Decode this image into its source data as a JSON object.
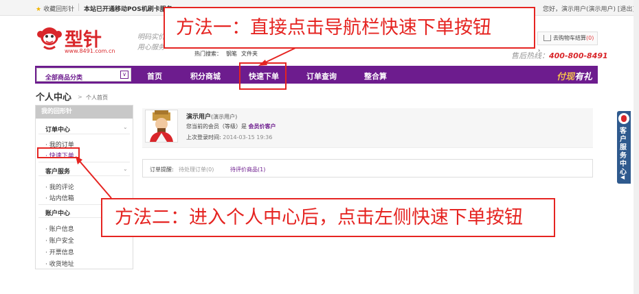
{
  "topbar": {
    "favorite": "收藏回形针",
    "notice": "本站已开通移动POS机刷卡服务",
    "user": "您好，演示用户(演示用户) [退出]"
  },
  "header": {
    "logo_text": "型针",
    "logo_url": "www.8491.com.cn",
    "slogan_line1": "明码实价",
    "slogan_line2": "用心服务",
    "hot_label": "热门搜索：",
    "hot_links": [
      "钢笔",
      "文件夹"
    ],
    "cart_label": "去购物车结算",
    "cart_count": "(0)",
    "hotline_label": "售后热线：",
    "hotline_number": "400-800-8491"
  },
  "nav": {
    "category_label": "全部商品分类",
    "items": [
      "首页",
      "积分商城",
      "快速下单",
      "订单查询",
      "整合算"
    ],
    "promo_a": "付现",
    "promo_b": "有礼"
  },
  "breadcrumb": {
    "title": "个人中心",
    "sep": ">",
    "page": "个人首页"
  },
  "sidebar": {
    "header": "我的回形针",
    "groups": [
      {
        "title": "订单中心",
        "items": [
          "· 我的订单",
          "· 快速下单"
        ]
      },
      {
        "title": "客户服务",
        "items": [
          "· 我的评论",
          "· 站内信箱"
        ]
      },
      {
        "title": "账户中心",
        "items": [
          "· 账户信息",
          "· 账户安全",
          "· 开票信息",
          "· 收货地址"
        ]
      }
    ]
  },
  "profile": {
    "name": "演示用户",
    "name_sub": "(演示用户)",
    "level_label": "您当前的会员（等级）是",
    "level": "会员价客户",
    "last_login_label": "上次登录时间:",
    "last_login": "2014-03-15 19:36"
  },
  "reminder": {
    "label": "订单提醒:",
    "pending": "待处理订单(0)",
    "to_rate": "待评价商品(1)"
  },
  "float_tab": {
    "text": "客户服务中心",
    "arrow": "◀"
  },
  "annotations": {
    "method1": "方法一：直接点击导航栏快速下单按钮",
    "method2": "方法二：进入个人中心后，点击左侧快速下单按钮"
  },
  "colors": {
    "brand_purple": "#6d1c8e",
    "brand_red": "#d9262a",
    "annotation_red": "#e52421"
  }
}
